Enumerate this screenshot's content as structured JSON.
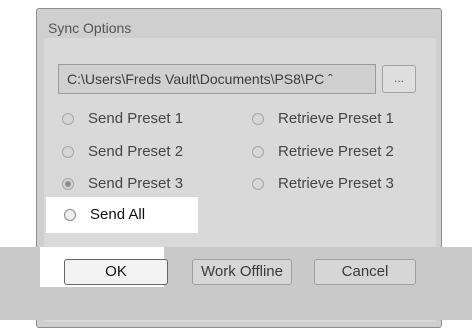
{
  "dialog": {
    "title": "Sync Options"
  },
  "path": {
    "value": "C:\\Users\\Freds Vault\\Documents\\PS8\\PC ˆ",
    "browse_label": "..."
  },
  "options": {
    "send": [
      {
        "label": "Send Preset 1",
        "checked": false
      },
      {
        "label": "Send Preset 2",
        "checked": false
      },
      {
        "label": "Send Preset 3",
        "checked": true
      },
      {
        "label": "Send All",
        "checked": false
      }
    ],
    "retrieve": [
      {
        "label": "Retrieve Preset 1",
        "checked": false
      },
      {
        "label": "Retrieve Preset 2",
        "checked": false
      },
      {
        "label": "Retrieve Preset 3",
        "checked": false
      }
    ]
  },
  "buttons": {
    "ok": "OK",
    "offline": "Work Offline",
    "cancel": "Cancel"
  }
}
